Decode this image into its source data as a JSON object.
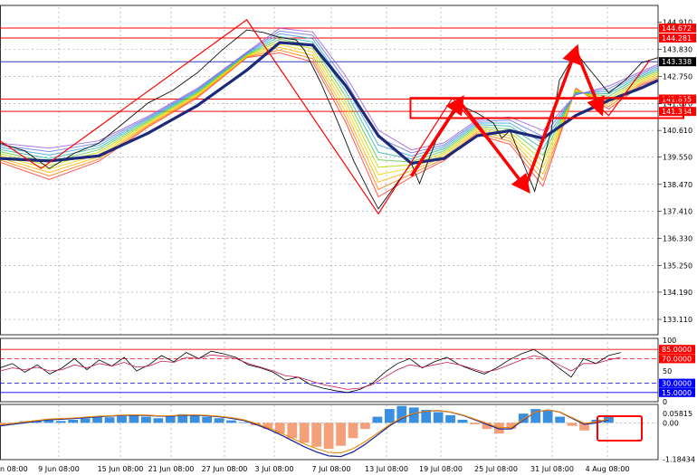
{
  "chart_data": [
    {
      "type": "line",
      "panel": "price",
      "y_ticks": [
        "144.910",
        "143.830",
        "142.750",
        "141.670",
        "140.610",
        "139.550",
        "138.470",
        "137.410",
        "136.330",
        "135.250",
        "134.190",
        "133.110"
      ],
      "y_values": [
        144.91,
        143.83,
        142.75,
        141.67,
        140.61,
        139.55,
        138.47,
        137.41,
        136.33,
        135.25,
        134.19,
        133.11
      ],
      "ylim": [
        132.5,
        145.5
      ],
      "x_ticks": [
        "9 Jun 08:00",
        "15 Jun 08:00",
        "21 Jun 08:00",
        "27 Jun 08:00",
        "3 Jul 08:00",
        "7 Jul 08:00",
        "13 Jul 08:00",
        "19 Jul 08:00",
        "25 Jul 08:00",
        "31 Jul 08:00",
        "4 Aug 08:00"
      ],
      "x_first_partial": "n 08:00",
      "grid": true,
      "price_levels": [
        {
          "value": 144.672,
          "label": "144.672",
          "color": "#ff0000"
        },
        {
          "value": 144.281,
          "label": "144.281",
          "color": "#ff0000"
        },
        {
          "value": 143.338,
          "label": "143.338",
          "color": "#2a3dbf"
        },
        {
          "value": 141.855,
          "label": "141.855",
          "color": "#ff0000"
        },
        {
          "value": 141.364,
          "label": "141.364",
          "color": "#ff0000"
        }
      ],
      "current_price": "143.338",
      "price_path": [
        [
          0,
          140.1
        ],
        [
          3,
          139.8
        ],
        [
          6,
          139.1
        ],
        [
          9,
          139.7
        ],
        [
          12,
          140.1
        ],
        [
          15,
          140.9
        ],
        [
          18,
          141.7
        ],
        [
          21,
          142.2
        ],
        [
          24,
          142.9
        ],
        [
          27,
          143.8
        ],
        [
          30,
          144.6
        ],
        [
          32,
          144.5
        ],
        [
          34,
          144.3
        ],
        [
          36,
          144.2
        ],
        [
          37,
          143.8
        ],
        [
          39,
          142.5
        ],
        [
          41,
          141.0
        ],
        [
          43,
          139.4
        ],
        [
          45,
          138.1
        ],
        [
          46,
          137.5
        ],
        [
          48,
          138.4
        ],
        [
          50,
          139.3
        ],
        [
          51,
          138.5
        ],
        [
          53,
          140.2
        ],
        [
          55,
          141.2
        ],
        [
          56,
          141.6
        ],
        [
          58,
          141.3
        ],
        [
          60,
          140.9
        ],
        [
          61,
          140.3
        ],
        [
          62,
          140.6
        ],
        [
          64,
          139.0
        ],
        [
          65,
          138.2
        ],
        [
          67,
          140.6
        ],
        [
          68,
          142.6
        ],
        [
          70,
          143.7
        ],
        [
          72,
          142.9
        ],
        [
          74,
          142.1
        ],
        [
          76,
          142.6
        ],
        [
          78,
          143.3
        ],
        [
          80,
          143.5
        ]
      ],
      "big_ma_path": [
        [
          0,
          139.5
        ],
        [
          6,
          139.4
        ],
        [
          12,
          139.6
        ],
        [
          18,
          140.5
        ],
        [
          24,
          141.6
        ],
        [
          30,
          143.0
        ],
        [
          34,
          144.1
        ],
        [
          38,
          144.0
        ],
        [
          42,
          142.4
        ],
        [
          46,
          140.4
        ],
        [
          50,
          139.3
        ],
        [
          54,
          139.5
        ],
        [
          58,
          140.4
        ],
        [
          62,
          140.6
        ],
        [
          66,
          140.3
        ],
        [
          70,
          141.2
        ],
        [
          74,
          141.8
        ],
        [
          78,
          142.3
        ],
        [
          80,
          142.6
        ]
      ],
      "zigzag": [
        [
          0,
          140.2
        ],
        [
          5,
          139.1
        ],
        [
          30,
          145.0
        ],
        [
          46,
          137.3
        ],
        [
          55,
          141.9
        ],
        [
          64,
          138.4
        ],
        [
          70,
          143.9
        ],
        [
          73,
          141.5
        ],
        [
          74,
          141.2
        ],
        [
          79,
          143.4
        ]
      ],
      "arrows": [
        [
          [
            50,
            138.8
          ],
          [
            56,
            141.8
          ]
        ],
        [
          [
            56,
            141.7
          ],
          [
            64,
            138.3
          ]
        ],
        [
          [
            64,
            138.5
          ],
          [
            70,
            143.8
          ]
        ],
        [
          [
            70,
            143.8
          ],
          [
            73,
            141.4
          ]
        ]
      ],
      "highlight_box": {
        "x": [
          51,
          82
        ],
        "y": [
          141.1,
          141.9
        ]
      }
    },
    {
      "type": "line",
      "panel": "oscillator",
      "y_ticks": [
        "100",
        "85.0000",
        "70.0000",
        "50",
        "30.0000",
        "15.0000",
        "0"
      ],
      "levels": [
        {
          "value": 85,
          "label": "85.0000",
          "color": "#ff0000"
        },
        {
          "value": 70,
          "label": "70.0000",
          "color": "#ff0000"
        },
        {
          "value": 30,
          "label": "30.0000",
          "color": "#0000ff"
        },
        {
          "value": 15,
          "label": "15.0000",
          "color": "#0000ff"
        }
      ],
      "ylim": [
        0,
        100
      ],
      "series": [
        {
          "values": [
            55,
            62,
            48,
            60,
            45,
            55,
            70,
            52,
            68,
            58,
            72,
            50,
            60,
            75,
            65,
            80,
            70,
            82,
            78,
            72,
            60,
            55,
            48,
            35,
            40,
            28,
            22,
            18,
            15,
            20,
            30,
            48,
            62,
            70,
            55,
            65,
            72,
            60,
            52,
            45,
            55,
            68,
            78,
            85,
            72,
            55,
            40,
            70,
            62,
            75,
            80
          ]
        },
        {
          "values": [
            50,
            55,
            52,
            56,
            50,
            52,
            60,
            55,
            62,
            58,
            64,
            56,
            58,
            66,
            64,
            72,
            70,
            76,
            74,
            70,
            62,
            56,
            50,
            42,
            40,
            34,
            28,
            24,
            20,
            22,
            28,
            40,
            52,
            60,
            56,
            60,
            64,
            60,
            54,
            48,
            52,
            60,
            68,
            75,
            70,
            60,
            50,
            62,
            62,
            68,
            72
          ]
        }
      ]
    },
    {
      "type": "bar",
      "panel": "macd",
      "y_ticks": [
        "0.05815",
        "0.00",
        "-1.18434"
      ],
      "ylim": [
        -1.2,
        0.6
      ],
      "histogram": [
        -0.05,
        -0.02,
        0.05,
        0.08,
        0.12,
        0.06,
        0.1,
        0.15,
        0.2,
        0.18,
        0.22,
        0.25,
        0.2,
        0.15,
        0.22,
        0.28,
        0.25,
        0.2,
        0.15,
        0.08,
        0.02,
        -0.08,
        -0.2,
        -0.35,
        -0.5,
        -0.65,
        -0.78,
        -0.85,
        -0.75,
        -0.5,
        -0.2,
        0.2,
        0.45,
        0.55,
        0.5,
        0.42,
        0.35,
        0.25,
        0.1,
        -0.05,
        -0.2,
        -0.35,
        -0.2,
        0.3,
        0.45,
        0.4,
        0.2,
        -0.1,
        -0.25,
        0.1,
        0.2
      ],
      "signal": [
        -0.1,
        -0.05,
        0.0,
        0.05,
        0.1,
        0.12,
        0.14,
        0.17,
        0.2,
        0.22,
        0.24,
        0.25,
        0.24,
        0.22,
        0.22,
        0.24,
        0.25,
        0.23,
        0.2,
        0.15,
        0.08,
        -0.05,
        -0.2,
        -0.38,
        -0.58,
        -0.78,
        -0.95,
        -1.08,
        -1.1,
        -0.95,
        -0.7,
        -0.4,
        -0.1,
        0.15,
        0.3,
        0.38,
        0.4,
        0.35,
        0.25,
        0.1,
        -0.05,
        -0.2,
        -0.2,
        0.1,
        0.35,
        0.42,
        0.35,
        0.15,
        -0.05,
        0.0,
        0.1
      ],
      "highlight_box": true
    }
  ]
}
